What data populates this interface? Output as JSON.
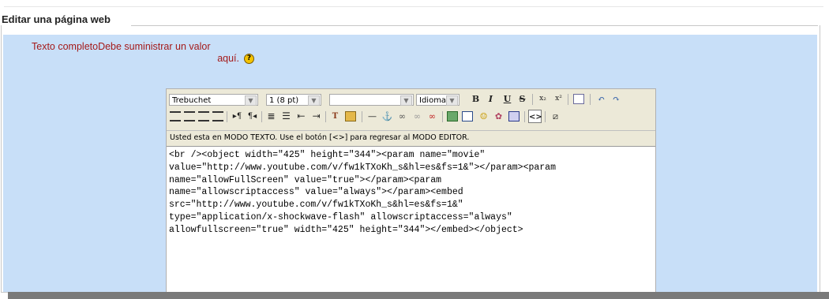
{
  "fieldset": {
    "legend": "Editar una página web"
  },
  "field": {
    "label_line1": "Texto completoDebe suministrar un valor",
    "label_line2": "aquí.",
    "help_glyph": "?"
  },
  "toolbar": {
    "font_family": "Trebuchet",
    "font_size": "1 (8 pt)",
    "format": "",
    "language": "Idioma",
    "bold": "B",
    "italic": "I",
    "underline": "U",
    "strike": "S",
    "subscript": "x₂",
    "superscript": "x²",
    "toggle_source": "<>"
  },
  "status": {
    "message": "Usted esta en MODO TEXTO. Use el botón [<>] para regresar al MODO EDITOR."
  },
  "editor": {
    "content": "<br /><object width=\"425\" height=\"344\"><param name=\"movie\"\nvalue=\"http://www.youtube.com/v/fw1kTXoKh_s&hl=es&fs=1&\"></param><param\nname=\"allowFullScreen\" value=\"true\"></param><param\nname=\"allowscriptaccess\" value=\"always\"></param><embed\nsrc=\"http://www.youtube.com/v/fw1kTXoKh_s&hl=es&fs=1&\"\ntype=\"application/x-shockwave-flash\" allowscriptaccess=\"always\"\nallowfullscreen=\"true\" width=\"425\" height=\"344\"></embed></object>"
  },
  "colors": {
    "panel_bg": "#c8dff8",
    "label_red": "#a41a1a",
    "toolbar_bg": "#ece9d8"
  }
}
